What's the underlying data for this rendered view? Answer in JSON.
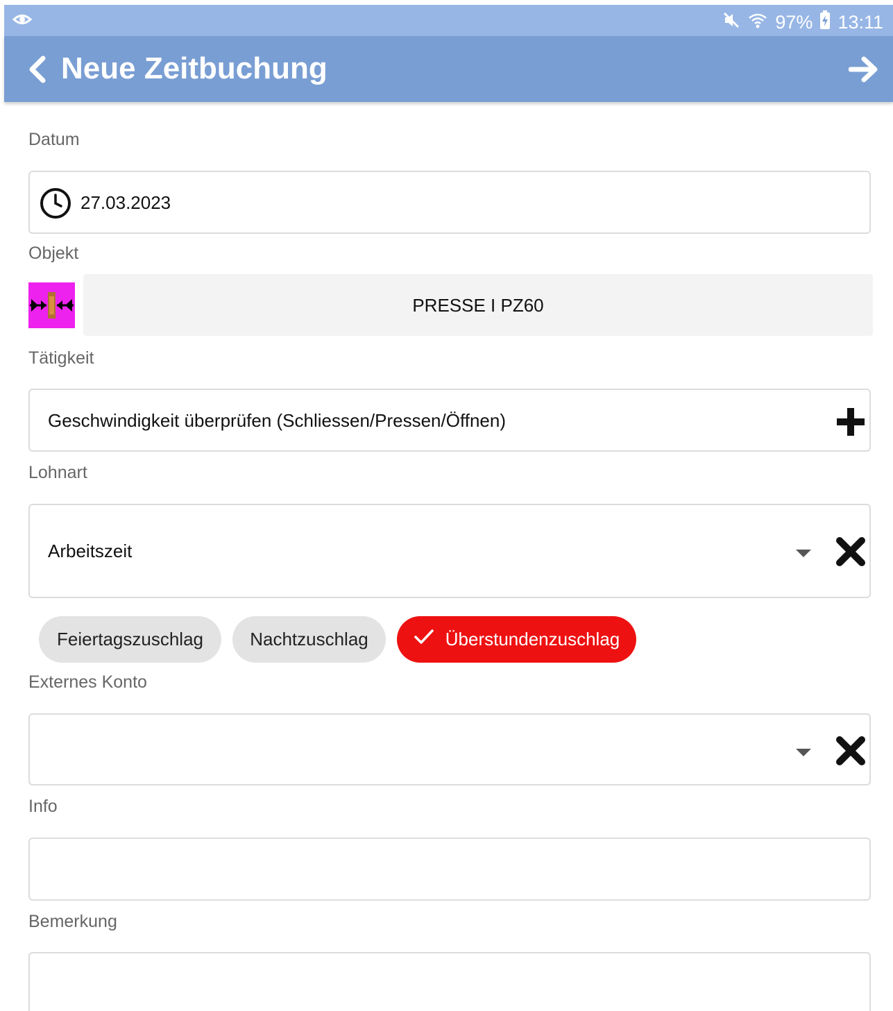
{
  "status_bar": {
    "battery": "97%",
    "time": "13:11"
  },
  "app_bar": {
    "title": "Neue Zeitbuchung"
  },
  "form": {
    "datum": {
      "label": "Datum",
      "value": "27.03.2023"
    },
    "objekt": {
      "label": "Objekt",
      "value": "PRESSE I PZ60"
    },
    "taetigkeit": {
      "label": "Tätigkeit",
      "value": "Geschwindigkeit überprüfen (Schliessen/Pressen/Öffnen)"
    },
    "lohnart": {
      "label": "Lohnart",
      "value": "Arbeitszeit"
    },
    "zuschlaege": [
      {
        "label": "Feiertagszuschlag",
        "selected": false
      },
      {
        "label": "Nachtzuschlag",
        "selected": false
      },
      {
        "label": "Überstundenzuschlag",
        "selected": true
      }
    ],
    "externes_konto": {
      "label": "Externes Konto",
      "value": ""
    },
    "info": {
      "label": "Info",
      "value": ""
    },
    "bemerkung": {
      "label": "Bemerkung",
      "value": ""
    }
  },
  "colors": {
    "status_bar": "#97b6e5",
    "app_bar": "#799ed3",
    "chip_selected": "#ee1111",
    "chip_default": "#e3e3e3"
  }
}
